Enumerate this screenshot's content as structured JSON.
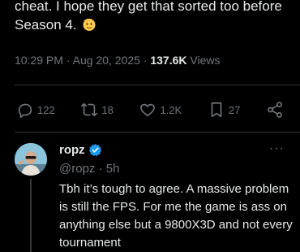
{
  "tweet": {
    "text": "cheat. I hope they get that sorted too before Season 4.",
    "time": "10:29 PM",
    "date": "Aug 20, 2025",
    "views_count": "137.6K",
    "views_label": "Views"
  },
  "actions": {
    "replies": "122",
    "reposts": "18",
    "likes": "1.2K",
    "bookmarks": "27"
  },
  "reply": {
    "name": "ropz",
    "handle": "@ropz",
    "age": "5h",
    "text": "Tbh it’s tough to agree. A massive problem is still the FPS. For me the game is ass on anything else but a 9800X3D and not every tournament"
  },
  "colors": {
    "background": "#000000",
    "text": "#e7e9ea",
    "muted": "#71767b",
    "verified": "#1d9bf0",
    "divider": "#2f3336"
  },
  "icons": {
    "reply": "reply-icon",
    "repost": "repost-icon",
    "like": "heart-icon",
    "bookmark": "bookmark-icon",
    "share": "share-icon",
    "verified": "verified-badge-icon",
    "more": "more-dots-icon"
  }
}
